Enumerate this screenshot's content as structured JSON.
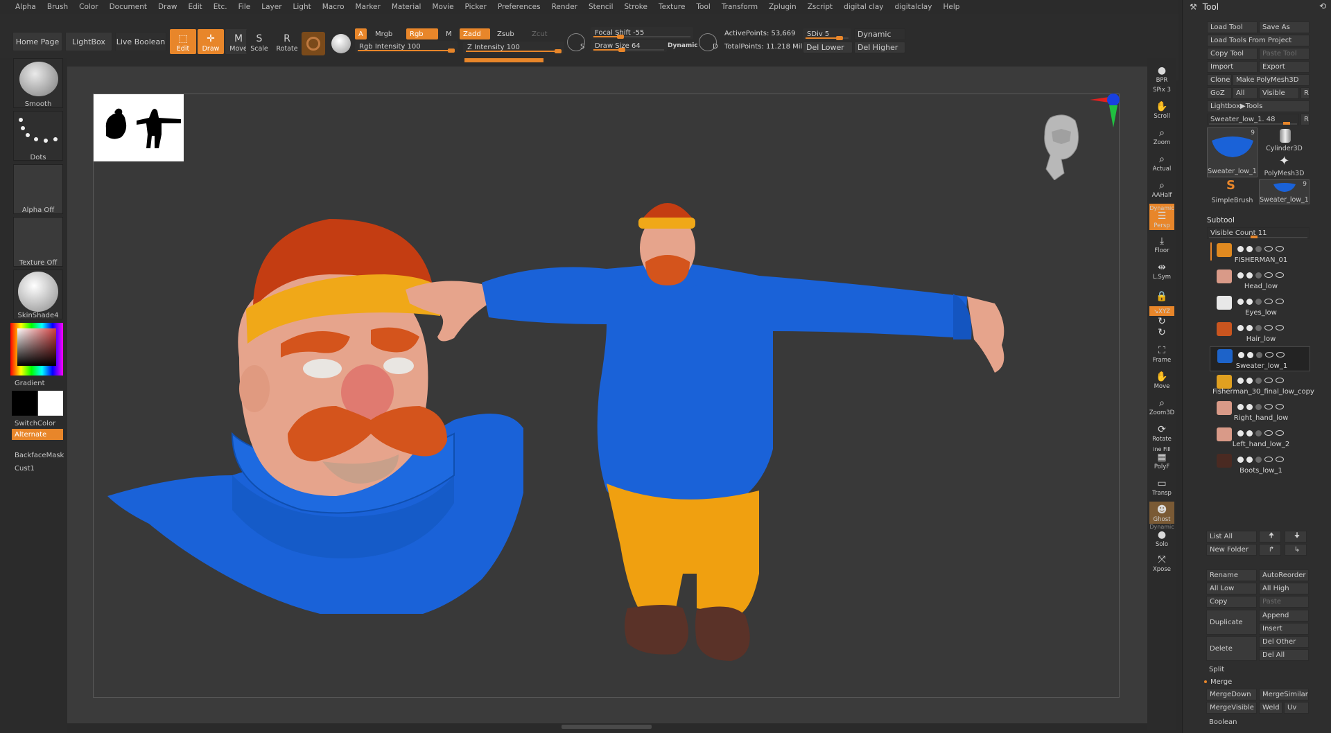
{
  "menu": [
    "Alpha",
    "Brush",
    "Color",
    "Document",
    "Draw",
    "Edit",
    "Etc.",
    "File",
    "Layer",
    "Light",
    "Macro",
    "Marker",
    "Material",
    "Movie",
    "Picker",
    "Preferences",
    "Render",
    "Stencil",
    "Stroke",
    "Texture",
    "Tool",
    "Transform",
    "Zplugin",
    "Zscript",
    "digital clay",
    "digitalclay",
    "Help"
  ],
  "top": {
    "home_page": "Home Page",
    "lightbox": "LightBox",
    "live_boolean": "Live Boolean",
    "edit": "Edit",
    "draw": "Draw",
    "move": "Move",
    "scale": "Scale",
    "rotate": "Rotate",
    "a_chip": "A",
    "mrgb": "Mrgb",
    "rgb": "Rgb",
    "m": "M",
    "zadd": "Zadd",
    "zsub": "Zsub",
    "zcut": "Zcut",
    "rgb_intensity": "Rgb Intensity 100",
    "z_intensity": "Z Intensity 100",
    "focal_shift": "Focal Shift -55",
    "draw_size": "Draw Size  64",
    "dynamic": "Dynamic",
    "active_points": "ActivePoints: 53,669",
    "total_points": "TotalPoints: 11.218 Mil",
    "sdiv": "SDiv 5",
    "dynamic2": "Dynamic",
    "del_lower": "Del Lower",
    "del_higher": "Del Higher",
    "s_label": "S",
    "d_label": "D"
  },
  "left": {
    "smooth": "Smooth",
    "dots": "Dots",
    "alpha_off": "Alpha Off",
    "texture_off": "Texture Off",
    "skinshade": "SkinShade4",
    "gradient": "Gradient",
    "switchcolor": "SwitchColor",
    "alternate": "Alternate",
    "backfacemask": "BackfaceMask",
    "cust1": "Cust1"
  },
  "rightbar": {
    "bpr": "BPR",
    "spix": "SPix 3",
    "scroll": "Scroll",
    "zoom": "Zoom",
    "actual": "Actual",
    "aahalf": "AAHalf",
    "dynamic": "Dynamic",
    "persp": "Persp",
    "floor": "Floor",
    "lsym": "L.Sym",
    "xyz": "↘XYZ",
    "frame": "Frame",
    "move": "Move",
    "zoom3d": "Zoom3D",
    "rotate": "Rotate",
    "line_fill": "ine Fill",
    "polyf": "PolyF",
    "transp": "Transp",
    "ghost": "Ghost",
    "dynamic2": "Dynamic",
    "solo": "Solo",
    "xpose": "Xpose"
  },
  "palette": {
    "title": "Tool",
    "load_tool": "Load Tool",
    "save_as": "Save As",
    "load_from_project": "Load Tools From Project",
    "copy_tool": "Copy Tool",
    "paste_tool": "Paste Tool",
    "import": "Import",
    "export": "Export",
    "clone": "Clone",
    "make_polymesh": "Make PolyMesh3D",
    "goz": "GoZ",
    "all": "All",
    "visible": "Visible",
    "r": "R",
    "lightbox_tools": "Lightbox▶Tools",
    "tool_slider": "Sweater_low_1. 48",
    "r2": "R",
    "tiles": [
      {
        "name": "Sweater_low_1",
        "count": "9"
      },
      {
        "name": "Cylinder3D",
        "count": ""
      },
      {
        "name": "PolyMesh3D",
        "count": ""
      },
      {
        "name": "SimpleBrush",
        "count": ""
      },
      {
        "name": "Sweater_low_1",
        "count": "9"
      }
    ],
    "subtool_header": "Subtool",
    "visible_count": "Visible Count 11",
    "subtools": [
      {
        "name": "FISHERMAN_01",
        "color": "#e08a20"
      },
      {
        "name": "Head_low",
        "color": "#d99a88"
      },
      {
        "name": "Eyes_low",
        "color": "#e8e8e8"
      },
      {
        "name": "Hair_low",
        "color": "#c9551f"
      },
      {
        "name": "Sweater_low_1",
        "color": "#1d63c9"
      },
      {
        "name": "Fisherman_30_final_low_copy",
        "color": "#e0a020"
      },
      {
        "name": "Right_hand_low",
        "color": "#d99a88"
      },
      {
        "name": "Left_hand_low_2",
        "color": "#d99a88"
      },
      {
        "name": "Boots_low_1",
        "color": "#4a2a22"
      }
    ],
    "list_all": "List All",
    "new_folder": "New Folder",
    "rename": "Rename",
    "autoreorder": "AutoReorder",
    "all_low": "All Low",
    "all_high": "All High",
    "copy": "Copy",
    "paste": "Paste",
    "append": "Append",
    "duplicate": "Duplicate",
    "insert": "Insert",
    "del_other": "Del Other",
    "delete": "Delete",
    "del_all": "Del All",
    "split": "Split",
    "merge": "Merge",
    "mergedown": "MergeDown",
    "mergesimilar": "MergeSimilar",
    "mergevisible": "MergeVisible",
    "weld": "Weld",
    "uv": "Uv",
    "boolean": "Boolean"
  },
  "colors": {
    "accent": "#e8862a",
    "sweater": "#1a62d8",
    "hat": "#c43d12",
    "band": "#f0a818",
    "pants": "#f0a010",
    "skin": "#e6a48c",
    "beard": "#d4541c",
    "boots": "#5a3228"
  }
}
